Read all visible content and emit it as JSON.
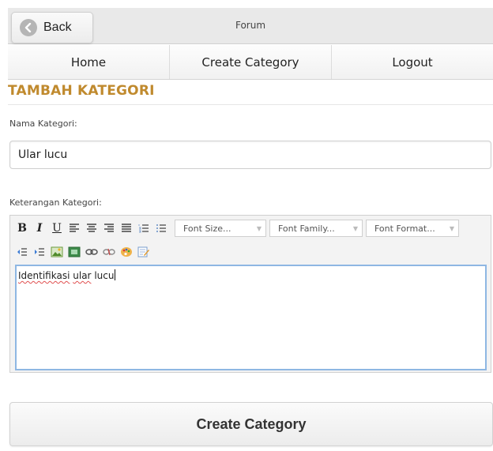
{
  "header": {
    "back_label": "Back",
    "title": "Forum"
  },
  "nav": {
    "items": [
      {
        "label": "Home"
      },
      {
        "label": "Create Category"
      },
      {
        "label": "Logout"
      }
    ]
  },
  "page": {
    "heading": "TAMBAH KATEGORI"
  },
  "form": {
    "name_label": "Nama Kategori:",
    "name_value": "Ular lucu",
    "desc_label": "Keterangan Kategori:",
    "editor_text_word1": "Identifikasi",
    "editor_text_word2": "ular",
    "editor_text_word3": "lucu",
    "submit_label": "Create Category"
  },
  "editor_toolbar": {
    "bold": "B",
    "italic": "I",
    "underline": "U",
    "font_size": "Font Size...",
    "font_family": "Font Family...",
    "font_format": "Font Format..."
  },
  "colors": {
    "accent_heading": "#c08a2e",
    "editor_focus": "#8eb7e3",
    "spell_error": "#e05050"
  }
}
